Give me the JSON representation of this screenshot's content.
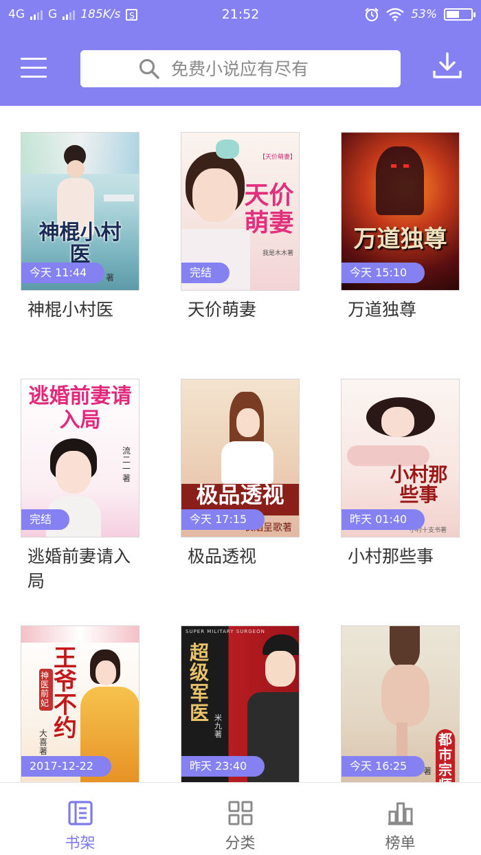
{
  "status_bar": {
    "network1": "4G",
    "network2": "G",
    "speed": "185K/s",
    "s_icon_label": "S",
    "time": "21:52",
    "battery": "53%",
    "battery_level": 0.53
  },
  "header": {
    "search_placeholder": "免费小说应有尽有",
    "icons": {
      "menu": "menu-icon",
      "search": "search-icon",
      "download": "download-icon"
    }
  },
  "colors": {
    "accent": "#8581f3",
    "tag_bg": "#8581f3",
    "nav_active": "#7d79ef",
    "nav_inactive": "#888888"
  },
  "books": [
    {
      "title": "神棍小村医",
      "tag": "今天 11:44",
      "cover_title": "神棍小村医",
      "cover_credit": "著"
    },
    {
      "title": "天价萌妻",
      "tag": "完结",
      "cover_title": "天价萌妻",
      "cover_credit": "我是木木著",
      "cover_small": "【天价萌妻】"
    },
    {
      "title": "万道独尊",
      "tag": "今天 15:10",
      "cover_title": "万道独尊"
    },
    {
      "title": "逃婚前妻请入局",
      "tag": "完结",
      "cover_title": "逃婚前妻请入局",
      "cover_credit": "流二一著"
    },
    {
      "title": "极品透视",
      "tag": "今天 17:15",
      "cover_title": "极品透视",
      "cover_credit": "长烟呈歌著"
    },
    {
      "title": "小村那些事",
      "tag": "昨天 01:40",
      "cover_title": "小村那些事",
      "cover_credit": "小村十支书著"
    },
    {
      "title": "",
      "tag": "2017-12-22",
      "cover_title": "王爷不约",
      "cover_credit": "大喜著",
      "cover_small": "神医前妃"
    },
    {
      "title": "",
      "tag": "昨天 23:40",
      "cover_title": "超级军医",
      "cover_credit": "米九著",
      "cover_small": "SUPER MILITARY SURGEON"
    },
    {
      "title": "",
      "tag": "今天 16:25",
      "cover_title": "都市宗师",
      "cover_credit": "著"
    }
  ],
  "bottom_nav": [
    {
      "label": "书架",
      "icon": "bookshelf-icon",
      "active": true
    },
    {
      "label": "分类",
      "icon": "category-grid-icon",
      "active": false
    },
    {
      "label": "榜单",
      "icon": "ranking-bars-icon",
      "active": false
    }
  ]
}
